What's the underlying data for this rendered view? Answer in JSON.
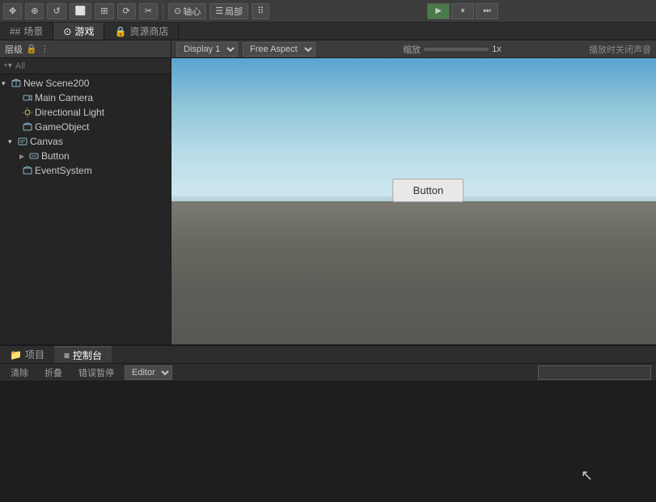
{
  "toolbar": {
    "tools": [
      "⊕",
      "✥",
      "↺",
      "⬜",
      "⊞",
      "⟳",
      "✂"
    ],
    "axis_label": "轴心",
    "local_label": "局部",
    "grid_label": "",
    "play_btn": "▶",
    "pause_btn": "⏸",
    "step_btn": "⏭"
  },
  "tabs": {
    "scene": "场景",
    "game": "游戏",
    "asset_store": "资源商店",
    "scene_icon": "##",
    "game_icon": "⊙",
    "asset_icon": "🔒"
  },
  "hierarchy": {
    "title": "层级",
    "search_placeholder": "All",
    "items": [
      {
        "id": "scene",
        "label": "New Scene200",
        "indent": 0,
        "arrow": "▾",
        "selected": false
      },
      {
        "id": "camera",
        "label": "Main Camera",
        "indent": 1,
        "arrow": "",
        "selected": false
      },
      {
        "id": "light",
        "label": "Directional Light",
        "indent": 1,
        "arrow": "",
        "selected": false
      },
      {
        "id": "gameobj",
        "label": "GameObject",
        "indent": 1,
        "arrow": "",
        "selected": false
      },
      {
        "id": "canvas",
        "label": "Canvas",
        "indent": 1,
        "arrow": "▾",
        "selected": false
      },
      {
        "id": "button",
        "label": "Button",
        "indent": 2,
        "arrow": "▶",
        "selected": false
      },
      {
        "id": "eventsys",
        "label": "EventSystem",
        "indent": 1,
        "arrow": "",
        "selected": false
      }
    ]
  },
  "game_view": {
    "display_label": "Display 1",
    "aspect_label": "Free Aspect",
    "scale_label": "缩放",
    "scale_value": "1x",
    "play_label": "播放时关闭声音",
    "button_label": "Button"
  },
  "bottom": {
    "project_tab": "项目",
    "console_tab": "控制台",
    "clear_btn": "清除",
    "collapse_btn": "折叠",
    "error_pause_btn": "错误暂停",
    "editor_label": "Editor",
    "search_placeholder": ""
  }
}
